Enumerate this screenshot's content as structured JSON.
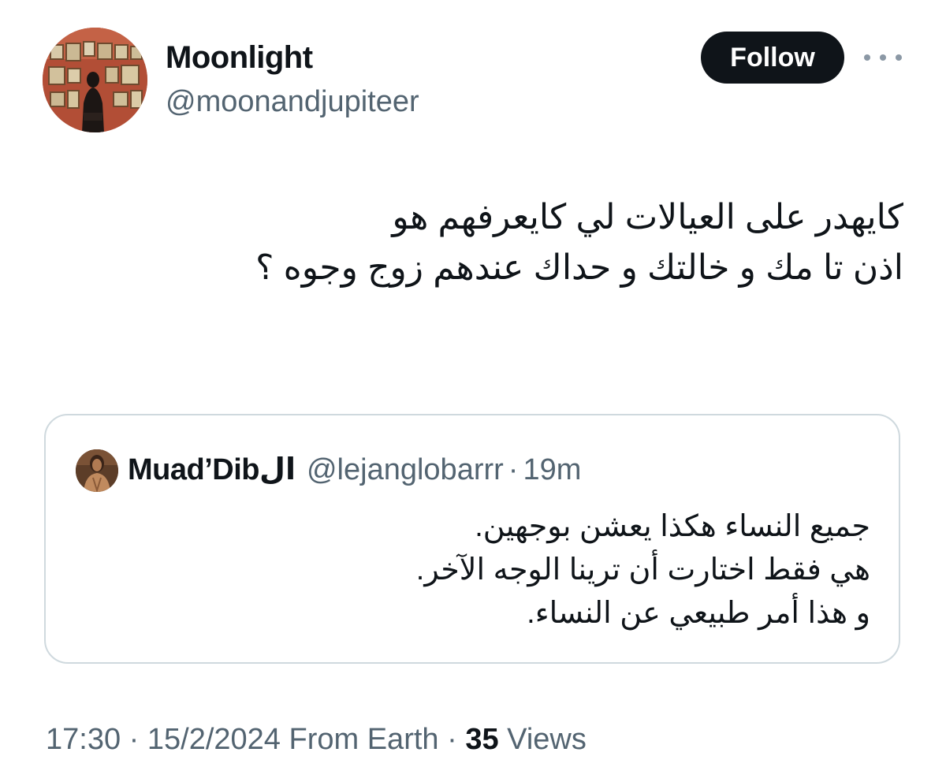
{
  "author": {
    "display_name": "Moonlight",
    "handle": "@moonandjupiteer"
  },
  "follow_button": {
    "label": "Follow"
  },
  "more_icon": "more-horizontal-icon",
  "tweet": {
    "lines": [
      "كايهدر على العيالات لي كايعرفهم هو",
      "اذن تا مك و خالتك و حداك عندهم زوج وجوه ؟"
    ]
  },
  "quote": {
    "display_name": "Muad’Dibال",
    "handle": "@lejanglobarrr",
    "separator": "·",
    "time": "19m",
    "lines": [
      "جميع النساء هكذا يعشن بوجهين.",
      "هي فقط اختارت أن ترينا الوجه الآخر.",
      "و هذا أمر طبيعي عن النساء."
    ]
  },
  "meta": {
    "time": "17:30",
    "separator": "·",
    "date": "15/2/2024",
    "source": "From Earth",
    "views_count": "35",
    "views_label": "Views"
  },
  "colors": {
    "text_primary": "#0f1419",
    "text_secondary": "#536471",
    "border": "#cfd9de",
    "button_bg": "#0f1419",
    "button_text": "#ffffff"
  }
}
